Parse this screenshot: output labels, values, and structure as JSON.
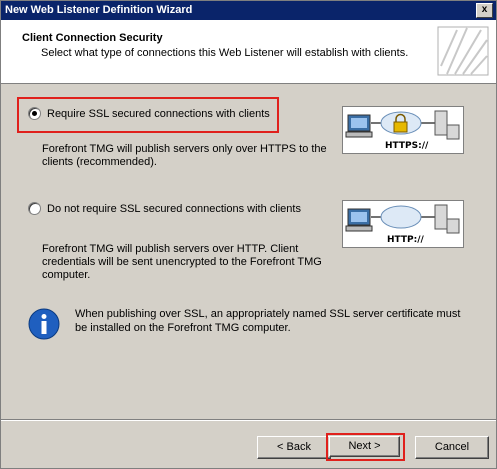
{
  "window": {
    "title": "New Web Listener Definition Wizard",
    "close_glyph": "x"
  },
  "header": {
    "title": "Client Connection Security",
    "subtitle": "Select what type of connections this Web Listener will establish with clients."
  },
  "options": [
    {
      "label": "Require SSL secured connections with clients",
      "selected": true,
      "description": "Forefront TMG will publish servers only over HTTPS to the clients (recommended).",
      "diagram_label": "HTTPS://"
    },
    {
      "label": "Do not require SSL secured connections with clients",
      "selected": false,
      "description": "Forefront TMG will publish servers over HTTP. Client credentials will be sent unencrypted to the Forefront TMG computer.",
      "diagram_label": "HTTP://"
    }
  ],
  "info": {
    "icon": "info-icon",
    "text": "When publishing over SSL, an appropriately named SSL server certificate must be installed on the Forefront TMG computer."
  },
  "buttons": {
    "back": "< Back",
    "next": "Next >",
    "cancel": "Cancel"
  },
  "colors": {
    "highlight": "#e0201c",
    "titlebar": "#0a246a",
    "dialog_bg": "#d4d0c8"
  }
}
